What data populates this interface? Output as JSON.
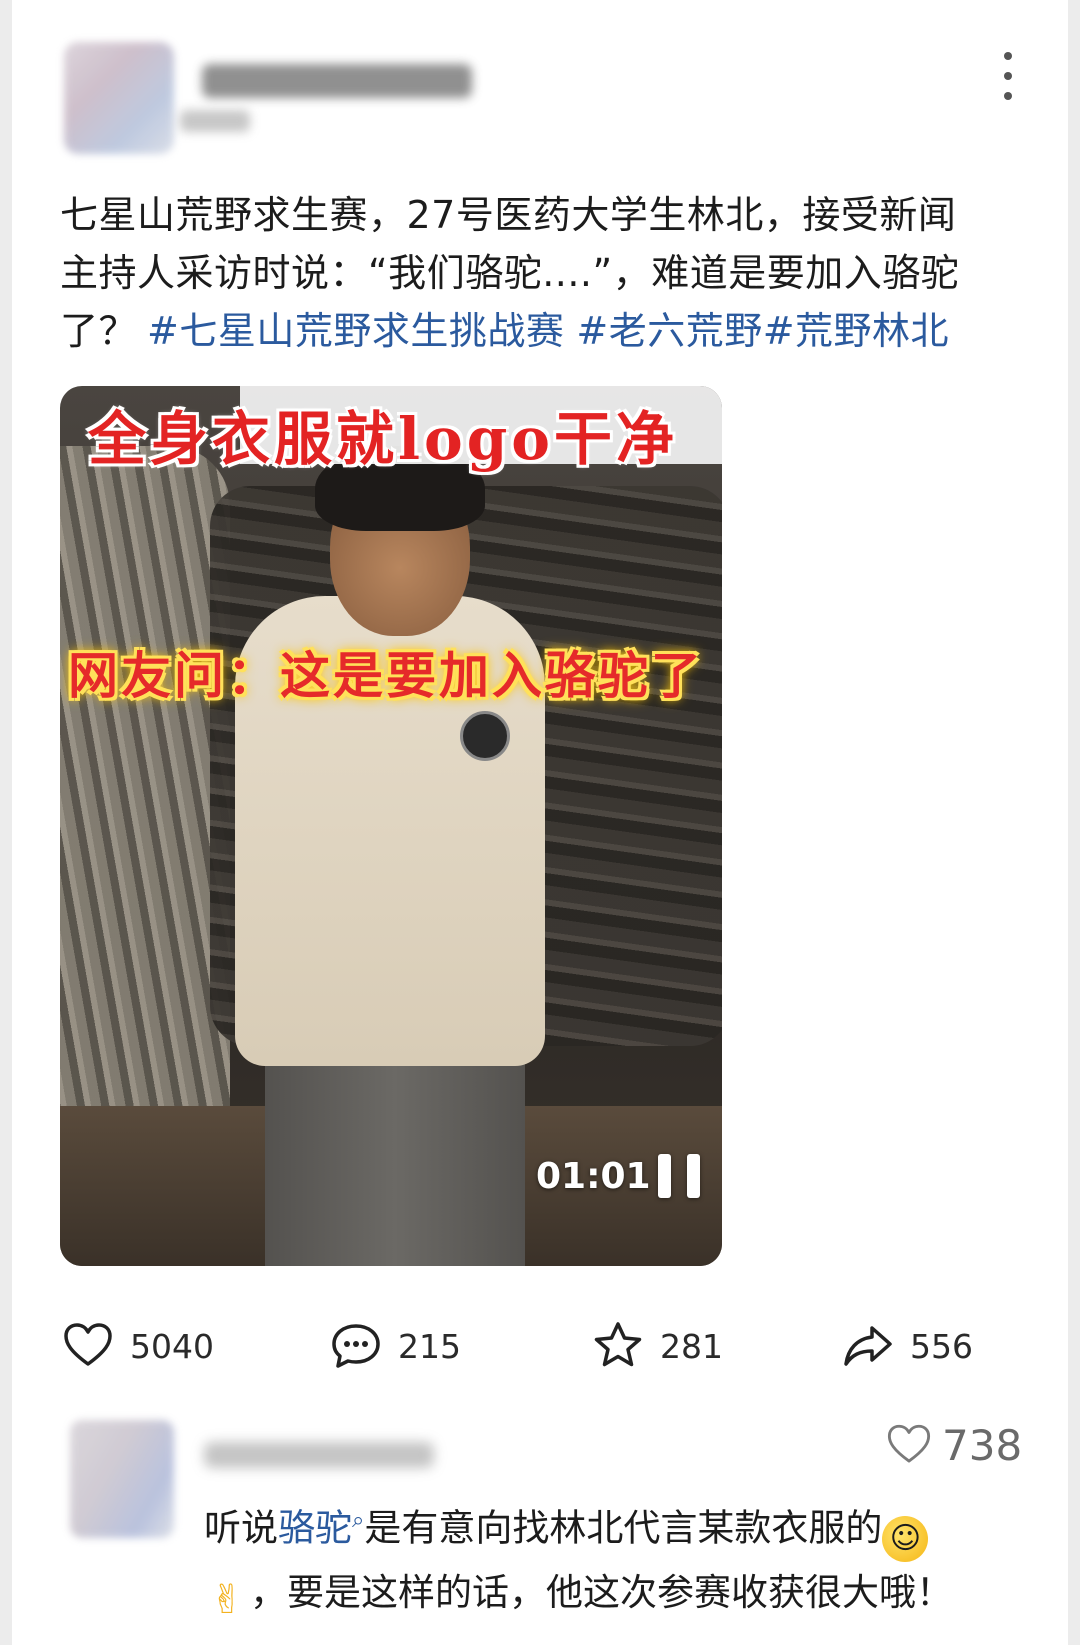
{
  "post": {
    "text_lines": [
      "七星山荒野求生赛，27号医药大学生林北，接受新闻",
      "主持人采访时说：“我们骆驼....”，难道是要加入骆驼",
      "了？"
    ],
    "hashtags": [
      "#七星山荒野求生挑战赛",
      "#老六荒野",
      "#荒野林北"
    ]
  },
  "video": {
    "caption_top": "全身衣服就logo干净",
    "caption_mid": "网友问：这是要加入骆驼了",
    "time": "01:01",
    "state_icon": "pause-icon"
  },
  "actions": {
    "like": {
      "icon": "heart-icon",
      "count": "5040"
    },
    "comment": {
      "icon": "comment-icon",
      "count": "215"
    },
    "favorite": {
      "icon": "star-icon",
      "count": "281"
    },
    "share": {
      "icon": "share-icon",
      "count": "556"
    }
  },
  "comment": {
    "likes": "738",
    "prefix": "听说",
    "link": "骆驼",
    "line1_rest": "是有意向找林北代言某款衣服的",
    "line2": "，要是这样的话，他这次参赛收获很大哦！"
  },
  "colors": {
    "link": "#2b5a9e",
    "caption_red": "#e32323",
    "caption_glow": "#ffd400"
  }
}
